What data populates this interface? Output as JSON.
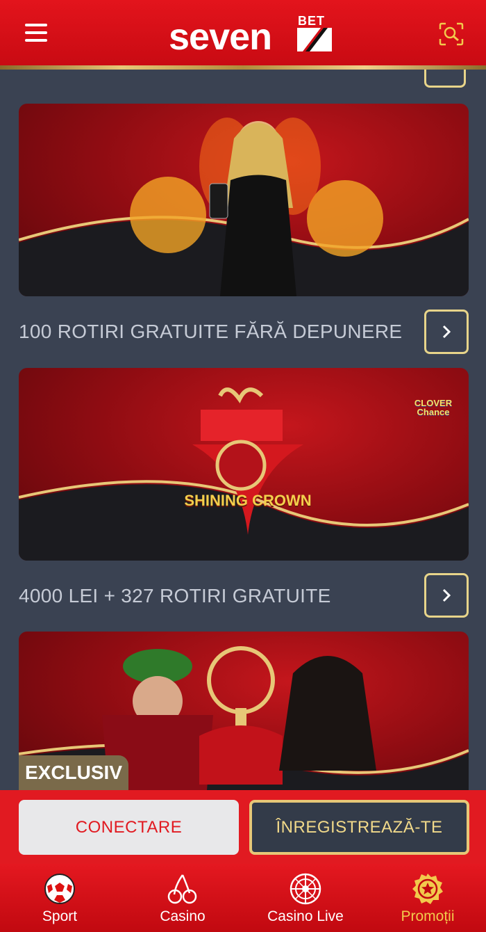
{
  "header": {
    "logo_text": "seven",
    "logo_badge": "BET",
    "menu_icon": "hamburger-icon",
    "search_icon": "search-icon"
  },
  "promotions": [
    {
      "title": "100 ROTIRI GRATUITE FĂRĂ DEPUNERE"
    },
    {
      "title": "4000 LEI + 327 ROTIRI GRATUITE",
      "banner_text": "SHINING CROWN",
      "banner_badge": "CLOVER Chance"
    },
    {
      "badge": "EXCLUSIV"
    }
  ],
  "auth": {
    "login_label": "CONECTARE",
    "register_label": "ÎNREGISTREAZĂ-TE"
  },
  "nav": [
    {
      "label": "Sport",
      "icon": "soccer-ball-icon"
    },
    {
      "label": "Casino",
      "icon": "cherries-icon"
    },
    {
      "label": "Casino Live",
      "icon": "roulette-icon"
    },
    {
      "label": "Promoții",
      "icon": "promo-star-icon",
      "active": true
    }
  ],
  "colors": {
    "brand_red": "#e11a21",
    "gold": "#e7c777",
    "background": "#3a4252"
  }
}
